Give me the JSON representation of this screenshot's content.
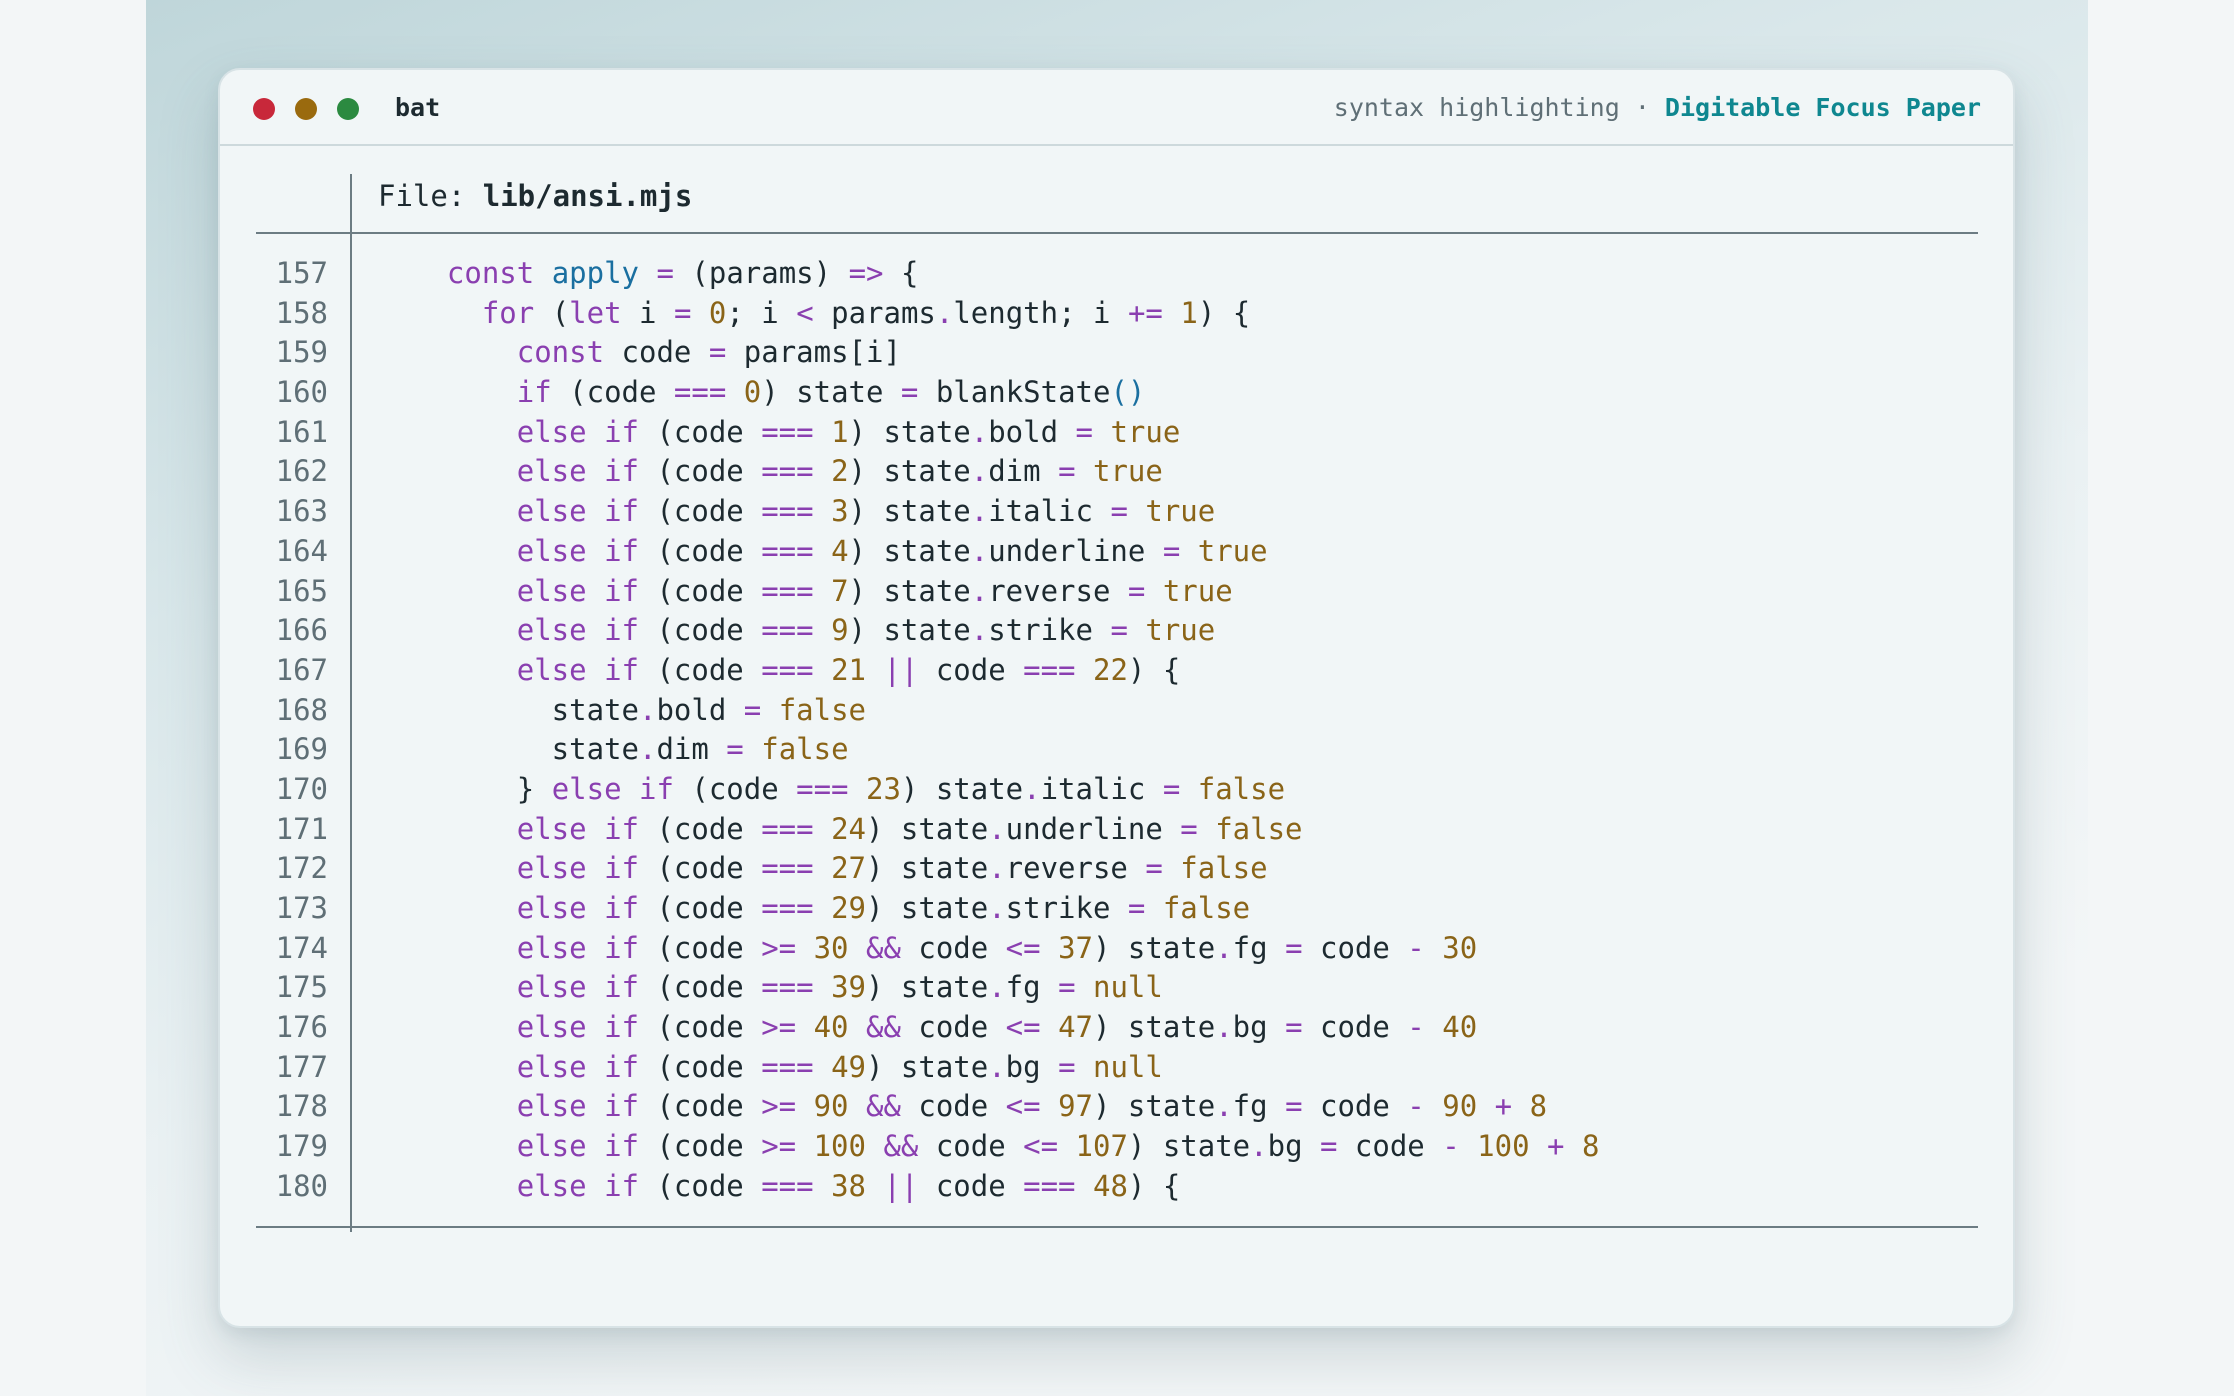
{
  "window": {
    "app_name": "bat",
    "subtitle": "syntax highlighting",
    "separator": " · ",
    "theme_name": "Digitable Focus Paper"
  },
  "file": {
    "label": "File: ",
    "name": "lib/ansi.mjs"
  },
  "colors": {
    "keyword": "#8a3fb0",
    "function": "#1a6fa0",
    "number": "#8a6418",
    "text": "#1d2a30",
    "line_number": "#5f6f76",
    "accent": "#0f8790"
  },
  "code_lines": [
    {
      "n": "157",
      "t": [
        [
          "",
          "  "
        ],
        [
          "k",
          "const"
        ],
        [
          "",
          " "
        ],
        [
          "f",
          "apply"
        ],
        [
          "",
          " "
        ],
        [
          "o",
          "="
        ],
        [
          "",
          " (params) "
        ],
        [
          "o",
          "=>"
        ],
        [
          "",
          " {"
        ]
      ]
    },
    {
      "n": "158",
      "t": [
        [
          "",
          "    "
        ],
        [
          "k",
          "for"
        ],
        [
          "",
          " ("
        ],
        [
          "k",
          "let"
        ],
        [
          "",
          " i "
        ],
        [
          "o",
          "="
        ],
        [
          "",
          " "
        ],
        [
          "n",
          "0"
        ],
        [
          "",
          "; i "
        ],
        [
          "o",
          "<"
        ],
        [
          "",
          " params"
        ],
        [
          "o",
          "."
        ],
        [
          "",
          "length; i "
        ],
        [
          "o",
          "+="
        ],
        [
          "",
          " "
        ],
        [
          "n",
          "1"
        ],
        [
          "",
          ") {"
        ]
      ]
    },
    {
      "n": "159",
      "t": [
        [
          "",
          "      "
        ],
        [
          "k",
          "const"
        ],
        [
          "",
          " code "
        ],
        [
          "o",
          "="
        ],
        [
          "",
          " params[i]"
        ]
      ]
    },
    {
      "n": "160",
      "t": [
        [
          "",
          "      "
        ],
        [
          "k",
          "if"
        ],
        [
          "",
          " (code "
        ],
        [
          "o",
          "==="
        ],
        [
          "",
          " "
        ],
        [
          "n",
          "0"
        ],
        [
          "",
          ") state "
        ],
        [
          "o",
          "="
        ],
        [
          "",
          " blankState"
        ],
        [
          "p",
          "()"
        ]
      ]
    },
    {
      "n": "161",
      "t": [
        [
          "",
          "      "
        ],
        [
          "k",
          "else if"
        ],
        [
          "",
          " (code "
        ],
        [
          "o",
          "==="
        ],
        [
          "",
          " "
        ],
        [
          "n",
          "1"
        ],
        [
          "",
          ") state"
        ],
        [
          "o",
          "."
        ],
        [
          "",
          "bold "
        ],
        [
          "o",
          "="
        ],
        [
          "",
          " "
        ],
        [
          "n",
          "true"
        ]
      ]
    },
    {
      "n": "162",
      "t": [
        [
          "",
          "      "
        ],
        [
          "k",
          "else if"
        ],
        [
          "",
          " (code "
        ],
        [
          "o",
          "==="
        ],
        [
          "",
          " "
        ],
        [
          "n",
          "2"
        ],
        [
          "",
          ") state"
        ],
        [
          "o",
          "."
        ],
        [
          "",
          "dim "
        ],
        [
          "o",
          "="
        ],
        [
          "",
          " "
        ],
        [
          "n",
          "true"
        ]
      ]
    },
    {
      "n": "163",
      "t": [
        [
          "",
          "      "
        ],
        [
          "k",
          "else if"
        ],
        [
          "",
          " (code "
        ],
        [
          "o",
          "==="
        ],
        [
          "",
          " "
        ],
        [
          "n",
          "3"
        ],
        [
          "",
          ") state"
        ],
        [
          "o",
          "."
        ],
        [
          "",
          "italic "
        ],
        [
          "o",
          "="
        ],
        [
          "",
          " "
        ],
        [
          "n",
          "true"
        ]
      ]
    },
    {
      "n": "164",
      "t": [
        [
          "",
          "      "
        ],
        [
          "k",
          "else if"
        ],
        [
          "",
          " (code "
        ],
        [
          "o",
          "==="
        ],
        [
          "",
          " "
        ],
        [
          "n",
          "4"
        ],
        [
          "",
          ") state"
        ],
        [
          "o",
          "."
        ],
        [
          "",
          "underline "
        ],
        [
          "o",
          "="
        ],
        [
          "",
          " "
        ],
        [
          "n",
          "true"
        ]
      ]
    },
    {
      "n": "165",
      "t": [
        [
          "",
          "      "
        ],
        [
          "k",
          "else if"
        ],
        [
          "",
          " (code "
        ],
        [
          "o",
          "==="
        ],
        [
          "",
          " "
        ],
        [
          "n",
          "7"
        ],
        [
          "",
          ") state"
        ],
        [
          "o",
          "."
        ],
        [
          "",
          "reverse "
        ],
        [
          "o",
          "="
        ],
        [
          "",
          " "
        ],
        [
          "n",
          "true"
        ]
      ]
    },
    {
      "n": "166",
      "t": [
        [
          "",
          "      "
        ],
        [
          "k",
          "else if"
        ],
        [
          "",
          " (code "
        ],
        [
          "o",
          "==="
        ],
        [
          "",
          " "
        ],
        [
          "n",
          "9"
        ],
        [
          "",
          ") state"
        ],
        [
          "o",
          "."
        ],
        [
          "",
          "strike "
        ],
        [
          "o",
          "="
        ],
        [
          "",
          " "
        ],
        [
          "n",
          "true"
        ]
      ]
    },
    {
      "n": "167",
      "t": [
        [
          "",
          "      "
        ],
        [
          "k",
          "else if"
        ],
        [
          "",
          " (code "
        ],
        [
          "o",
          "==="
        ],
        [
          "",
          " "
        ],
        [
          "n",
          "21"
        ],
        [
          "",
          " "
        ],
        [
          "o",
          "||"
        ],
        [
          "",
          " code "
        ],
        [
          "o",
          "==="
        ],
        [
          "",
          " "
        ],
        [
          "n",
          "22"
        ],
        [
          "",
          ") {"
        ]
      ]
    },
    {
      "n": "168",
      "t": [
        [
          "",
          "        state"
        ],
        [
          "o",
          "."
        ],
        [
          "",
          "bold "
        ],
        [
          "o",
          "="
        ],
        [
          "",
          " "
        ],
        [
          "n",
          "false"
        ]
      ]
    },
    {
      "n": "169",
      "t": [
        [
          "",
          "        state"
        ],
        [
          "o",
          "."
        ],
        [
          "",
          "dim "
        ],
        [
          "o",
          "="
        ],
        [
          "",
          " "
        ],
        [
          "n",
          "false"
        ]
      ]
    },
    {
      "n": "170",
      "t": [
        [
          "",
          "      } "
        ],
        [
          "k",
          "else if"
        ],
        [
          "",
          " (code "
        ],
        [
          "o",
          "==="
        ],
        [
          "",
          " "
        ],
        [
          "n",
          "23"
        ],
        [
          "",
          ") state"
        ],
        [
          "o",
          "."
        ],
        [
          "",
          "italic "
        ],
        [
          "o",
          "="
        ],
        [
          "",
          " "
        ],
        [
          "n",
          "false"
        ]
      ]
    },
    {
      "n": "171",
      "t": [
        [
          "",
          "      "
        ],
        [
          "k",
          "else if"
        ],
        [
          "",
          " (code "
        ],
        [
          "o",
          "==="
        ],
        [
          "",
          " "
        ],
        [
          "n",
          "24"
        ],
        [
          "",
          ") state"
        ],
        [
          "o",
          "."
        ],
        [
          "",
          "underline "
        ],
        [
          "o",
          "="
        ],
        [
          "",
          " "
        ],
        [
          "n",
          "false"
        ]
      ]
    },
    {
      "n": "172",
      "t": [
        [
          "",
          "      "
        ],
        [
          "k",
          "else if"
        ],
        [
          "",
          " (code "
        ],
        [
          "o",
          "==="
        ],
        [
          "",
          " "
        ],
        [
          "n",
          "27"
        ],
        [
          "",
          ") state"
        ],
        [
          "o",
          "."
        ],
        [
          "",
          "reverse "
        ],
        [
          "o",
          "="
        ],
        [
          "",
          " "
        ],
        [
          "n",
          "false"
        ]
      ]
    },
    {
      "n": "173",
      "t": [
        [
          "",
          "      "
        ],
        [
          "k",
          "else if"
        ],
        [
          "",
          " (code "
        ],
        [
          "o",
          "==="
        ],
        [
          "",
          " "
        ],
        [
          "n",
          "29"
        ],
        [
          "",
          ") state"
        ],
        [
          "o",
          "."
        ],
        [
          "",
          "strike "
        ],
        [
          "o",
          "="
        ],
        [
          "",
          " "
        ],
        [
          "n",
          "false"
        ]
      ]
    },
    {
      "n": "174",
      "t": [
        [
          "",
          "      "
        ],
        [
          "k",
          "else if"
        ],
        [
          "",
          " (code "
        ],
        [
          "o",
          ">="
        ],
        [
          "",
          " "
        ],
        [
          "n",
          "30"
        ],
        [
          "",
          " "
        ],
        [
          "o",
          "&&"
        ],
        [
          "",
          " code "
        ],
        [
          "o",
          "<="
        ],
        [
          "",
          " "
        ],
        [
          "n",
          "37"
        ],
        [
          "",
          ") state"
        ],
        [
          "o",
          "."
        ],
        [
          "",
          "fg "
        ],
        [
          "o",
          "="
        ],
        [
          "",
          " code "
        ],
        [
          "o",
          "-"
        ],
        [
          "",
          " "
        ],
        [
          "n",
          "30"
        ]
      ]
    },
    {
      "n": "175",
      "t": [
        [
          "",
          "      "
        ],
        [
          "k",
          "else if"
        ],
        [
          "",
          " (code "
        ],
        [
          "o",
          "==="
        ],
        [
          "",
          " "
        ],
        [
          "n",
          "39"
        ],
        [
          "",
          ") state"
        ],
        [
          "o",
          "."
        ],
        [
          "",
          "fg "
        ],
        [
          "o",
          "="
        ],
        [
          "",
          " "
        ],
        [
          "n",
          "null"
        ]
      ]
    },
    {
      "n": "176",
      "t": [
        [
          "",
          "      "
        ],
        [
          "k",
          "else if"
        ],
        [
          "",
          " (code "
        ],
        [
          "o",
          ">="
        ],
        [
          "",
          " "
        ],
        [
          "n",
          "40"
        ],
        [
          "",
          " "
        ],
        [
          "o",
          "&&"
        ],
        [
          "",
          " code "
        ],
        [
          "o",
          "<="
        ],
        [
          "",
          " "
        ],
        [
          "n",
          "47"
        ],
        [
          "",
          ") state"
        ],
        [
          "o",
          "."
        ],
        [
          "",
          "bg "
        ],
        [
          "o",
          "="
        ],
        [
          "",
          " code "
        ],
        [
          "o",
          "-"
        ],
        [
          "",
          " "
        ],
        [
          "n",
          "40"
        ]
      ]
    },
    {
      "n": "177",
      "t": [
        [
          "",
          "      "
        ],
        [
          "k",
          "else if"
        ],
        [
          "",
          " (code "
        ],
        [
          "o",
          "==="
        ],
        [
          "",
          " "
        ],
        [
          "n",
          "49"
        ],
        [
          "",
          ") state"
        ],
        [
          "o",
          "."
        ],
        [
          "",
          "bg "
        ],
        [
          "o",
          "="
        ],
        [
          "",
          " "
        ],
        [
          "n",
          "null"
        ]
      ]
    },
    {
      "n": "178",
      "t": [
        [
          "",
          "      "
        ],
        [
          "k",
          "else if"
        ],
        [
          "",
          " (code "
        ],
        [
          "o",
          ">="
        ],
        [
          "",
          " "
        ],
        [
          "n",
          "90"
        ],
        [
          "",
          " "
        ],
        [
          "o",
          "&&"
        ],
        [
          "",
          " code "
        ],
        [
          "o",
          "<="
        ],
        [
          "",
          " "
        ],
        [
          "n",
          "97"
        ],
        [
          "",
          ") state"
        ],
        [
          "o",
          "."
        ],
        [
          "",
          "fg "
        ],
        [
          "o",
          "="
        ],
        [
          "",
          " code "
        ],
        [
          "o",
          "-"
        ],
        [
          "",
          " "
        ],
        [
          "n",
          "90"
        ],
        [
          "",
          " "
        ],
        [
          "o",
          "+"
        ],
        [
          "",
          " "
        ],
        [
          "n",
          "8"
        ]
      ]
    },
    {
      "n": "179",
      "t": [
        [
          "",
          "      "
        ],
        [
          "k",
          "else if"
        ],
        [
          "",
          " (code "
        ],
        [
          "o",
          ">="
        ],
        [
          "",
          " "
        ],
        [
          "n",
          "100"
        ],
        [
          "",
          " "
        ],
        [
          "o",
          "&&"
        ],
        [
          "",
          " code "
        ],
        [
          "o",
          "<="
        ],
        [
          "",
          " "
        ],
        [
          "n",
          "107"
        ],
        [
          "",
          ") state"
        ],
        [
          "o",
          "."
        ],
        [
          "",
          "bg "
        ],
        [
          "o",
          "="
        ],
        [
          "",
          " code "
        ],
        [
          "o",
          "-"
        ],
        [
          "",
          " "
        ],
        [
          "n",
          "100"
        ],
        [
          "",
          " "
        ],
        [
          "o",
          "+"
        ],
        [
          "",
          " "
        ],
        [
          "n",
          "8"
        ]
      ]
    },
    {
      "n": "180",
      "t": [
        [
          "",
          "      "
        ],
        [
          "k",
          "else if"
        ],
        [
          "",
          " (code "
        ],
        [
          "o",
          "==="
        ],
        [
          "",
          " "
        ],
        [
          "n",
          "38"
        ],
        [
          "",
          " "
        ],
        [
          "o",
          "||"
        ],
        [
          "",
          " code "
        ],
        [
          "o",
          "==="
        ],
        [
          "",
          " "
        ],
        [
          "n",
          "48"
        ],
        [
          "",
          ") {"
        ]
      ]
    }
  ]
}
